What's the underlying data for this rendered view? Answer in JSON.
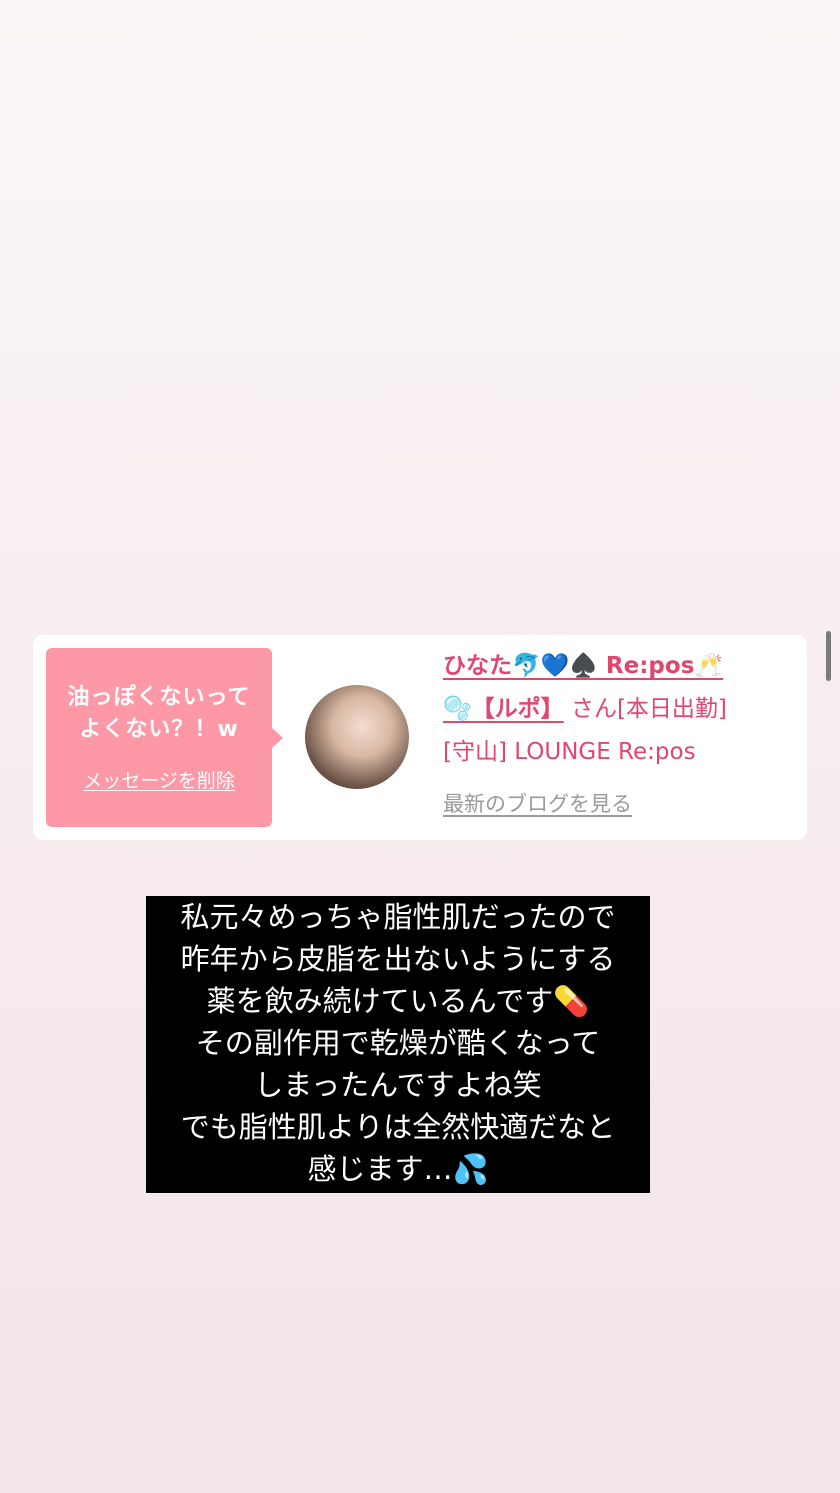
{
  "reply_card": {
    "message_lines": [
      "油っぽくないって",
      "よくない？！w"
    ],
    "delete_label": "メッセージを削除",
    "user_name": "ひなた🐬💙♠️ Re:pos🥂",
    "user_name_cont": "🫧【ルポ】",
    "honorific": "さん[本日出勤]",
    "shop": "[守山] LOUNGE Re:pos",
    "blog_link": "最新のブログを見る"
  },
  "caption": {
    "lines": [
      "私元々めっちゃ脂性肌だったので",
      "昨年から皮脂を出ないようにする",
      "薬を飲み続けているんです💊",
      "その副作用で乾燥が酷くなって",
      "しまったんですよね笑",
      "でも脂性肌よりは全然快適だなと",
      "感じます…💦"
    ]
  },
  "colors": {
    "accent": "#e0466f",
    "bubble": "#fd98a6",
    "caption_bg": "#000000"
  }
}
